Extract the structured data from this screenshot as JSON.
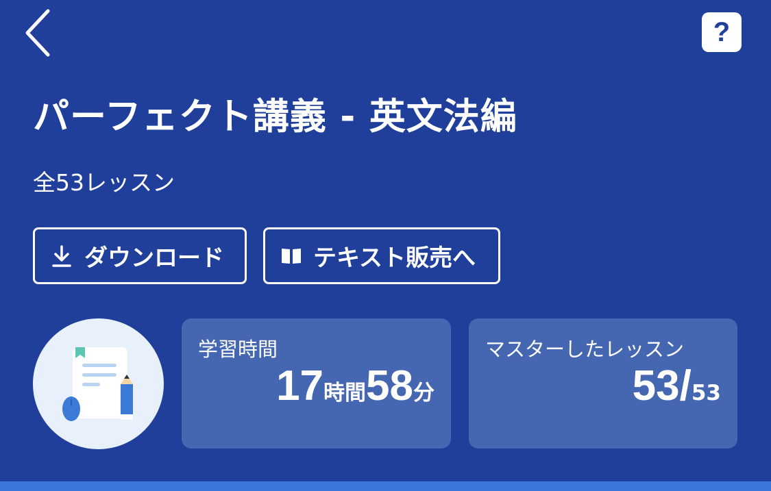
{
  "header": {
    "back_icon": "chevron-left-icon",
    "help_label": "?"
  },
  "course": {
    "title": "パーフェクト講義 - 英文法編",
    "lesson_count": "全53レッスン"
  },
  "actions": {
    "download_label": "ダウンロード",
    "download_icon": "download-icon",
    "text_sales_label": "テキスト販売へ",
    "text_sales_icon": "book-icon"
  },
  "stats": {
    "study_time": {
      "label": "学習時間",
      "hours": "17",
      "hours_unit": "時間",
      "minutes": "58",
      "minutes_unit": "分"
    },
    "mastered": {
      "label": "マスターしたレッスン",
      "done": "53/",
      "total": "53"
    }
  },
  "colors": {
    "background": "#1f3f9a",
    "card": "#4566b1",
    "accent_bar": "#3a78dc"
  }
}
